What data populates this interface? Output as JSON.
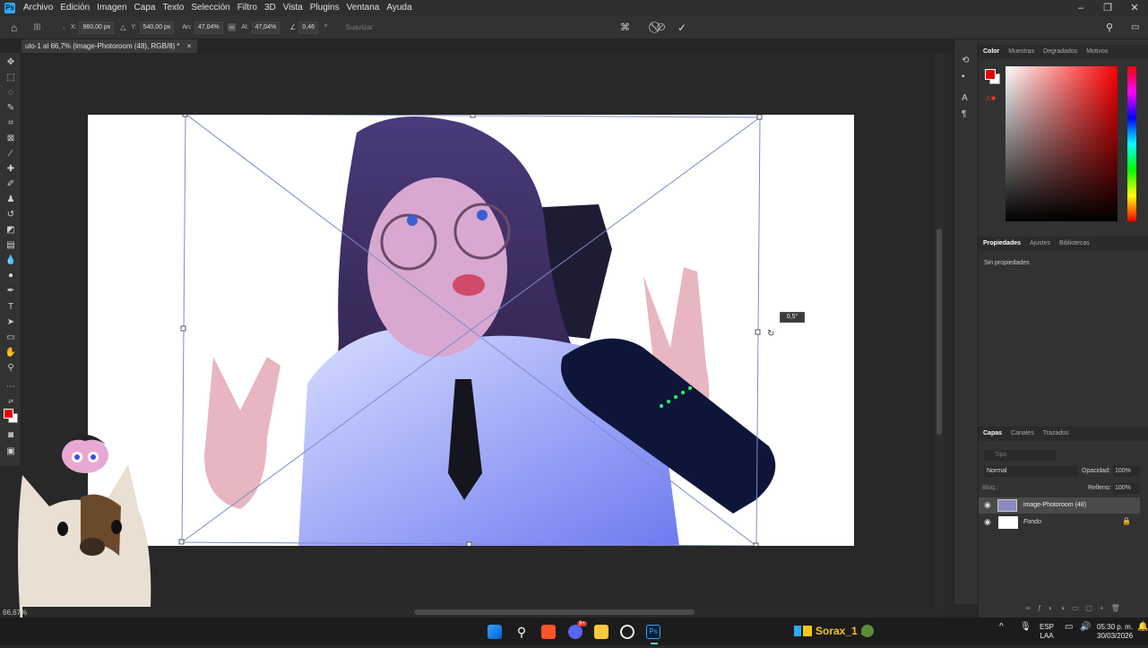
{
  "menu": {
    "logo": "Ps",
    "items": [
      "Archivo",
      "Edición",
      "Imagen",
      "Capa",
      "Texto",
      "Selección",
      "Filtro",
      "3D",
      "Vista",
      "Plugins",
      "Ventana",
      "Ayuda"
    ]
  },
  "options_bar": {
    "x_label": "X:",
    "x_value": "960,00 px",
    "y_label": "Y:",
    "y_value": "540,00 px",
    "w_label": "An:",
    "w_value": "47,04%",
    "h_label": "Al:",
    "h_value": "47,04%",
    "angle_value": "0,46",
    "angle_unit": "°",
    "interp_label": "Suavizar"
  },
  "document_tab": {
    "title": "ulo-1 al 66,7% (image-Photoroom (48), RGB/8) *",
    "close": "×"
  },
  "canvas": {
    "rotation_readout": "0,5°",
    "zoom": "66,67%"
  },
  "color_panel": {
    "tabs": [
      "Color",
      "Muestras",
      "Degradados",
      "Motivos"
    ],
    "foreground": "#e60000",
    "background": "#ffffff"
  },
  "properties_panel": {
    "tabs": [
      "Propiedades",
      "Ajustes",
      "Bibliotecas"
    ],
    "body": "Sin propiedades"
  },
  "layers_panel": {
    "tabs": [
      "Capas",
      "Canales",
      "Trazados"
    ],
    "filter_placeholder": "Tipo",
    "blend_mode": "Normal",
    "opacity_label": "Opacidad:",
    "opacity_value": "100%",
    "lock_label": "Bloq.:",
    "fill_label": "Relleno:",
    "fill_value": "100%",
    "layers": [
      {
        "name": "image-Photoroom (48)",
        "selected": true,
        "visible": true
      },
      {
        "name": "Fondo",
        "selected": false,
        "visible": true,
        "locked": true
      }
    ]
  },
  "taskbar": {
    "stream_label": "Sorax_1 :",
    "lang": "ESP",
    "region": "LAA",
    "time": "05:30 p. m.",
    "date": "30/03/2026",
    "badge_count": "9+"
  }
}
